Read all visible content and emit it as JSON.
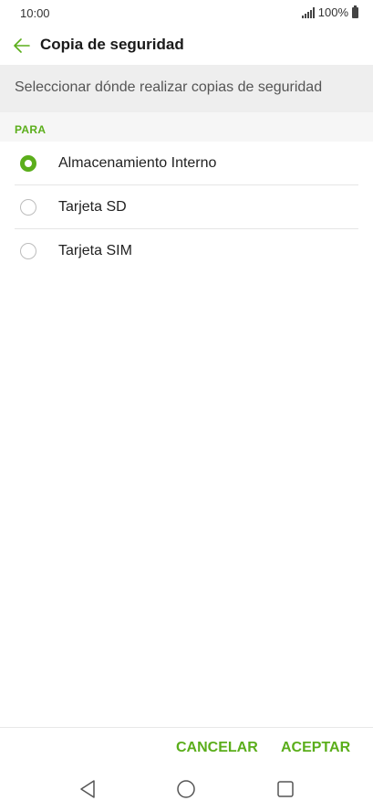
{
  "status_bar": {
    "time": "10:00",
    "battery": "100%"
  },
  "header": {
    "title": "Copia de seguridad"
  },
  "description": "Seleccionar dónde realizar copias de seguridad",
  "section": {
    "label": "PARA"
  },
  "options": [
    {
      "label": "Almacenamiento Interno",
      "selected": true
    },
    {
      "label": "Tarjeta SD",
      "selected": false
    },
    {
      "label": "Tarjeta SIM",
      "selected": false
    }
  ],
  "actions": {
    "cancel_label": "CANCELAR",
    "accept_label": "ACEPTAR"
  },
  "colors": {
    "accent": "#5bae1b",
    "description_background": "#eeeeee"
  },
  "icons": {
    "back": "arrow-left-icon",
    "signal": "signal-icon",
    "battery": "battery-icon",
    "nav_back": "nav-back-icon",
    "nav_home": "nav-home-icon",
    "nav_recent": "nav-recent-icon"
  }
}
